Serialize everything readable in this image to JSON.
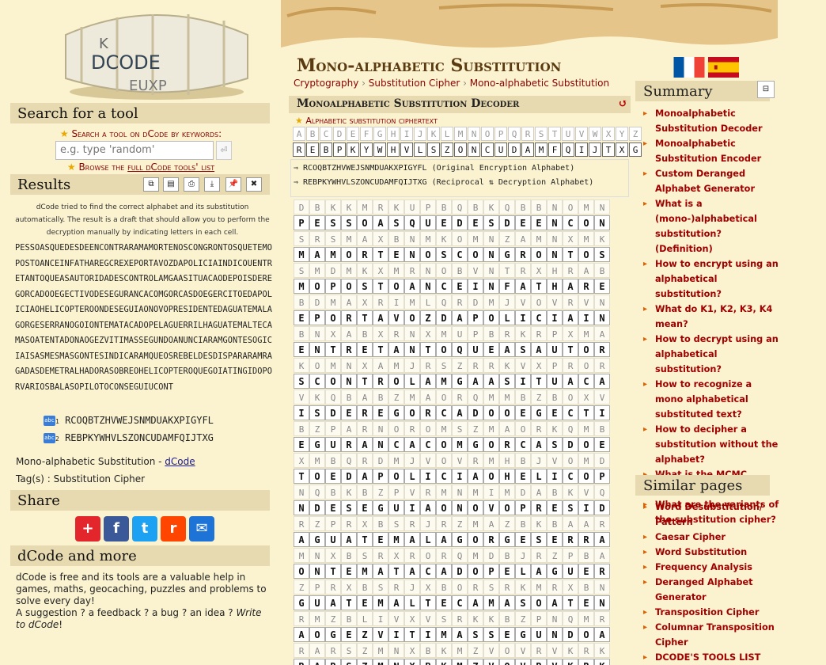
{
  "site": {
    "logo_text": "DCODE"
  },
  "search": {
    "heading": "Search for a tool",
    "label": "Search a tool on dCode by keywords:",
    "placeholder": "e.g. type 'random'",
    "go": "⏎",
    "browse_prefix": "Browse the ",
    "browse_link": "full dCode tools' list"
  },
  "results": {
    "heading": "Results",
    "toolbar": [
      "copy",
      "save",
      "print",
      "download",
      "pin",
      "close"
    ],
    "note": "dCode tried to find the correct alphabet and its substitution automatically. The result is a draft that should allow you to perform the decryption manually by indicating letters in each cell.",
    "text": "PESSOASQUEDESDEENCONTRARAMAMORTENOSCONGRONTOSQUETEMOPOSTOANCEINFATHAREGCREXEPORTAVOZDAPOLICIAINDICOUENTRETANTOQUEASAUTORIDADESCONTROLAMGAASITUACAODEPOISDEREGORCADOOEGECTIVODESEGURANCACOMGORCASDOEGERCITOEDAPOLICIAOHELICOPTEROONDESEGUIAONOVOPRESIDENTEDAGUATEMALAGORGESERRANOGOIONTEMATACADOPELAGUERRILHAGUATEMALTECAMASOATENTADONAOGEZVITIMASSEGUNDOANUNCIARAMGONTESOGICIAISASMESMASGONTESINDICARAMQUEOSREBELDESDISPARARAMRAGADASDEMETRALHADORASOBREOHELICOPTEROQUEGOIATINGIDOPORVARIOSBALASOPILOTOCONSEGUIUCONT",
    "alpha1": "RCOQBTZHVWEJSNMDUAKXPIGYFL",
    "alpha2": "REBPKYWHVLSZONCUDAMFQIJTXG"
  },
  "meta": {
    "tool_prefix": "Mono-alphabetic Substitution - ",
    "tool_link": "dCode",
    "tags": "Tag(s) : Substitution Cipher"
  },
  "share": {
    "heading": "Share",
    "buttons": [
      "+",
      "f",
      "t",
      "r",
      "✉"
    ]
  },
  "more": {
    "heading": "dCode and more",
    "text1": "dCode is free and its tools are a valuable help in games, maths, geocaching, puzzles and problems to solve every day!",
    "text2": "A suggestion ? a feedback ? a bug ? an idea ? ",
    "link": "Write to dCode",
    "end": "!"
  },
  "page": {
    "title": "Mono-alphabetic Substitution",
    "crumbs": [
      "Cryptography",
      "Substitution Cipher",
      "Mono-alphabetic Substitution"
    ]
  },
  "decoder": {
    "heading": "Monoalphabetic Substitution Decoder",
    "refresh": "↺",
    "ct_label": "Alphabetic substitution ciphertext",
    "plain": "ABCDEFGHIJKLMNOPQRSTUVWXYZ",
    "cipher": "REBPKYWHVLSZONCUDAMFQIJTXG",
    "info1": "⇒ RCOQBTZHVWEJSNMDUAKXPIGYFL (Original Encryption Alphabet)",
    "info2": "⇒ REBPKYWHVLSZONCUDAMFQIJTXG (Reciprocal ⇅ Decryption Alphabet)",
    "grid": [
      [
        "DBKKMRKUPBQBKQBBNOMNXARAR",
        "PESSOASQUEDESDEENCONTRARA"
      ],
      [
        "SRSMAXBNMKOMNZAMNXMKUPBXB",
        "MAMORTENOSCONGRONTOSQUETE"
      ],
      [
        "SMDMKXMRNOBVNTRXHRABZOABY",
        "MOPOSTOANCEINFATHAREGCREX"
      ],
      [
        "BDMAXRIMLQRDMJVOVRVNQVOMP",
        "EPORTAVOZDAPOLICIAINDICOU"
      ],
      [
        "BNXABXRNXMUPBRKRPXMAVQRQB",
        "ENTRETANTOQUEASAUTORIDADE"
      ],
      [
        "KOMNXAMJRSZRRKVXPRORMQBDM",
        "SCONTROLAMGAASITUACAODEPO"
      ],
      [
        "VKQBABZMAORQMMBZBOXVIMQBK",
        "ISDEREGORCADOOEGECTIVODES"
      ],
      [
        "BZPARNOROMSZMAORKQMBZBAOV",
        "EGURANCACOMGORCASDOEGERCI"
      ],
      [
        "XMBQRDMJVOVRMHBJVOMDXBAMM",
        "TOEDAPOLICIAOHELICOPTEROO"
      ],
      [
        "NQBKBZPVRMNMIMDABKVQBNXBQ",
        "NDESEGUIAONOVOPRESIDENTED"
      ],
      [
        "RZPRXBSRJRZMAZBKBAARNMZMV",
        "AGUATEMALAGORGESERRANOGOI"
      ],
      [
        "MNXBSRXRORQMDBJRZPBAAVJHR",
        "ONTEMATACADOPELAGUERRILHA"
      ],
      [
        "ZPRXBSRJXBORSRKMRXBNXRQMN",
        "GUATEMALTECAMASOATENTADON"
      ],
      [
        "RMZBLIVXVSRKKBZPNQMRRNPNOV",
        "AOGEZVITIMASSEGUNDOANUNCI"
      ],
      [
        "RARSZMNXBKMZVOVRVKRKSBKSR",
        "RARSZMNXBKMZVOVRVKRKSBKSR"
      ]
    ]
  },
  "summary": {
    "heading": "Summary",
    "collapse": "⊟",
    "items": [
      "Monoalphabetic Substitution Decoder",
      "Monoalphabetic Substitution Encoder",
      "Custom Deranged Alphabet Generator",
      "What is a (mono-)alphabetical substitution? (Definition)",
      "How to encrypt using an alphabetical substitution?",
      "What do K1, K2, K3, K4 mean?",
      "How to decrypt using an alphabetical substitution?",
      "How to recognize a mono alphabetical substituted text?",
      "How to decipher a substitution without the alphabet?",
      "What is the MCMC technique?",
      "What are the variants of the substitution cipher?"
    ]
  },
  "similar": {
    "heading": "Similar pages",
    "items": [
      "Word Desubstitution/ Pattern",
      "Caesar Cipher",
      "Word Substitution",
      "Frequency Analysis",
      "Deranged Alphabet Generator",
      "Transposition Cipher",
      "Columnar Transposition Cipher",
      "DCODE'S TOOLS LIST"
    ]
  },
  "colors": {
    "accent": "#8a0000",
    "header_bg": "#e8dab0",
    "page_bg": "#fbf2cf"
  }
}
